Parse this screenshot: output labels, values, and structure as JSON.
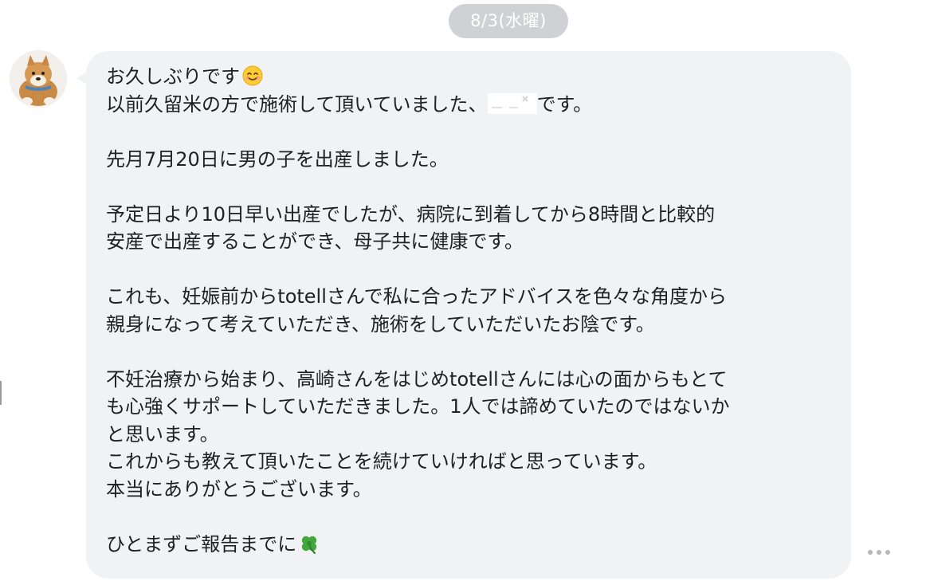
{
  "chat": {
    "date_separator": "8/3(水曜)",
    "message": {
      "line_1": "お久しぶりです",
      "line_1_emoji": "smiling-face-icon",
      "line_2_prefix": "以前久留米の方で施術して頂いていました、",
      "line_2_suffix": "です。",
      "line_4": "先月7月20日に男の子を出産しました。",
      "line_6": "予定日より10日早い出産でしたが、病院に到着してから8時間と比較的",
      "line_7": "安産で出産することができ、母子共に健康です。",
      "line_9": "これも、妊娠前からtotellさんで私に合ったアドバイスを色々な角度から",
      "line_10": "親身になって考えていただき、施術をしていただいたお陰です。",
      "line_12": "不妊治療から始まり、高崎さんをはじめtotellさんには心の面からもとて",
      "line_13": "も心強くサポートしていただきました。1人では諦めていたのではないか",
      "line_14": "と思います。",
      "line_15": "これからも教えて頂いたことを続けていければと思っています。",
      "line_16": "本当にありがとうございます。",
      "line_18": "ひとまずご報告までに",
      "line_18_emoji": "four-leaf-clover-icon"
    },
    "icons": {
      "avatar": "shiba-dog-avatar",
      "more": "more-options-icon"
    },
    "colors": {
      "bubble": "#f1f2f4",
      "date_pill": "#cfd1d4",
      "text": "#202124"
    }
  }
}
